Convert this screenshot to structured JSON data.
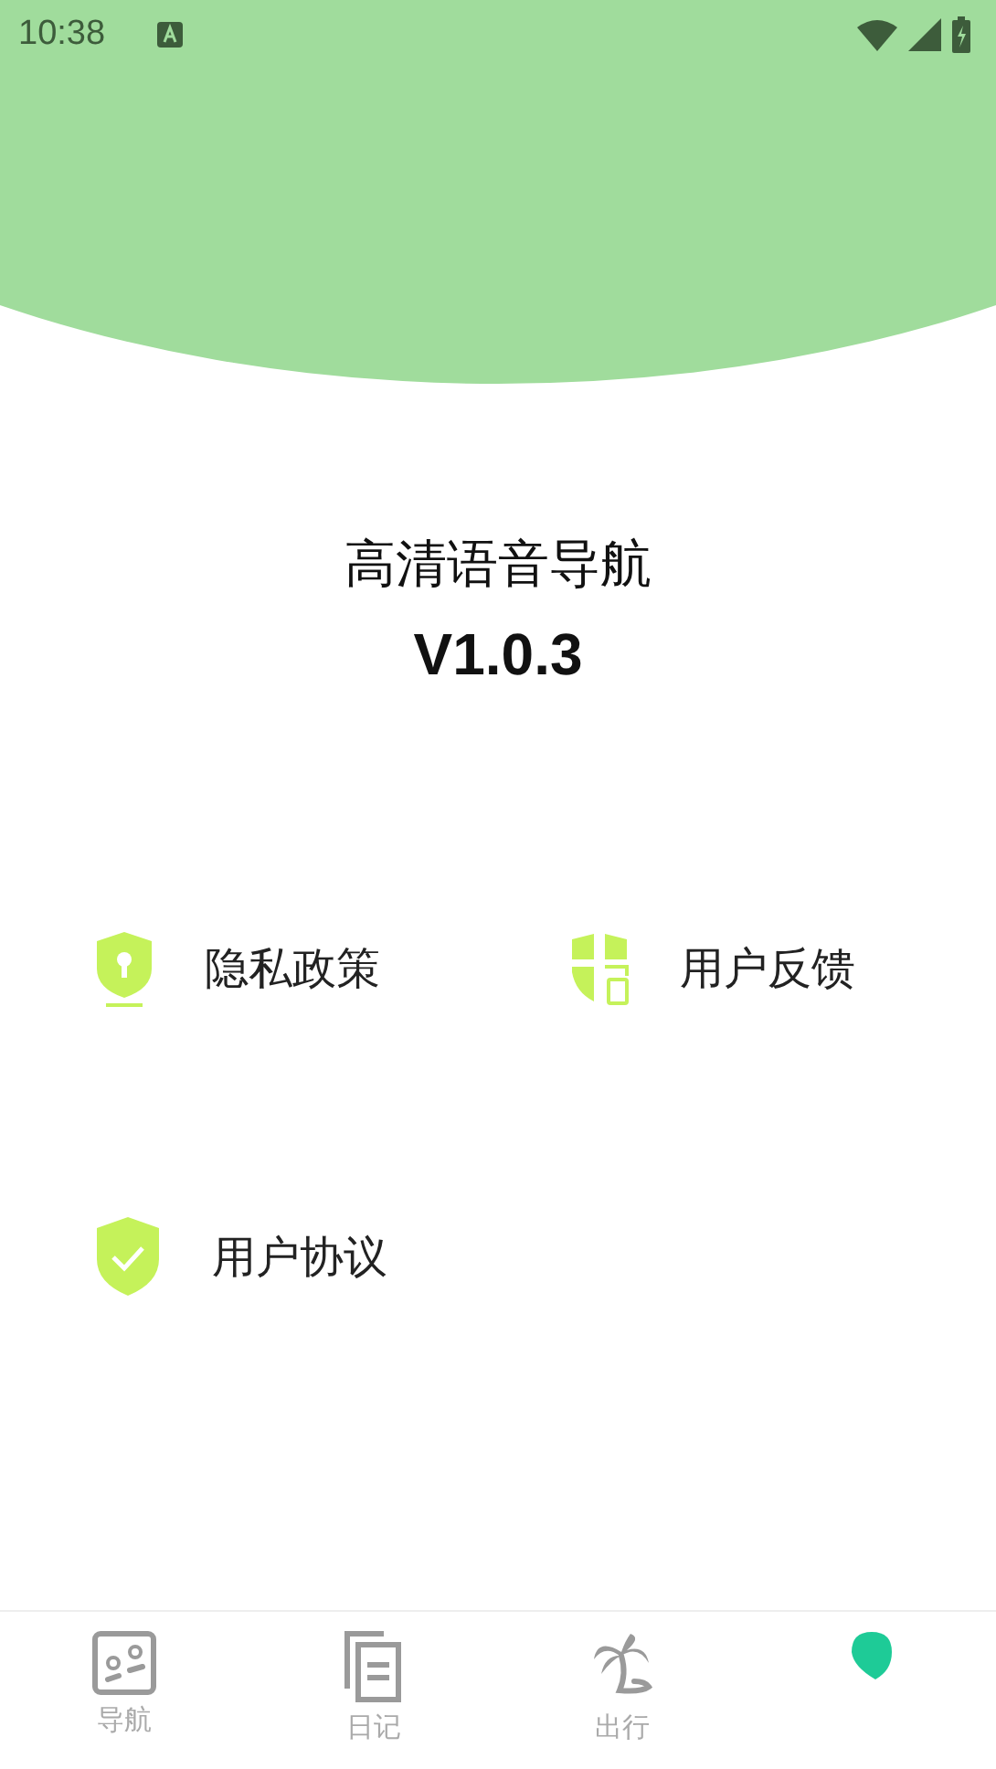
{
  "status_bar": {
    "time": "10:38"
  },
  "app": {
    "name": "高清语音导航",
    "version": "V1.0.3"
  },
  "menu": [
    {
      "kind": "privacy",
      "label": "隐私政策"
    },
    {
      "kind": "feedback",
      "label": "用户反馈"
    },
    {
      "kind": "agreement",
      "label": "用户协议"
    }
  ],
  "tabs": [
    {
      "kind": "map",
      "label": "导航",
      "selected": false
    },
    {
      "kind": "diary",
      "label": "日记",
      "selected": false
    },
    {
      "kind": "travel",
      "label": "出行",
      "selected": false
    },
    {
      "kind": "me",
      "selected": true
    }
  ]
}
